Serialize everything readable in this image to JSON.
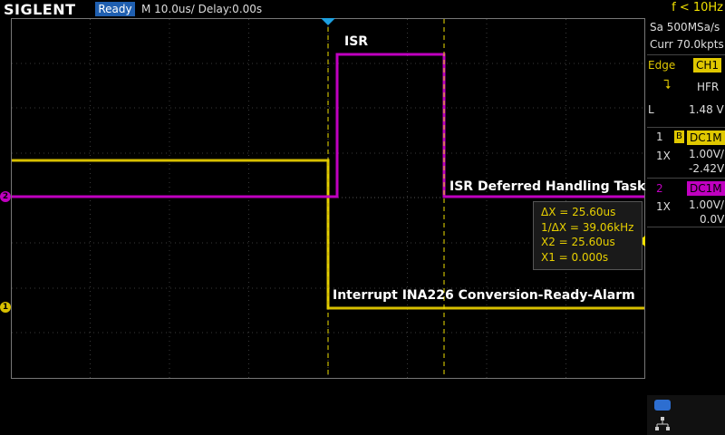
{
  "topbar": {
    "logo": "SIGLENT",
    "status": "Ready",
    "timebase": "M 10.0us/  Delay:0.00s",
    "frequency": "f < 10Hz"
  },
  "acquisition": {
    "sample_rate": "Sa 500MSa/s",
    "memory": "Curr 70.0kpts"
  },
  "trigger": {
    "type": "Edge",
    "source": "CH1",
    "coupling": "HFR",
    "level_prefix": "L",
    "level": "1.48 V"
  },
  "channels": [
    {
      "number": "1",
      "bw": "B",
      "coupling": "DC1M",
      "probe": "1X",
      "scale": "1.00V/",
      "offset": "-2.42V",
      "color": "#e0c800"
    },
    {
      "number": "2",
      "coupling": "DC1M",
      "probe": "1X",
      "scale": "1.00V/",
      "offset": "0.0V",
      "color": "#c000c0"
    }
  ],
  "labels": {
    "isr": "ISR",
    "deferred": "ISR Deferred Handling Task",
    "interrupt": "Interrupt INA226 Conversion-Ready-Alarm"
  },
  "cursors": {
    "delta_x": "ΔX = 25.60us",
    "inv_delta_x": "1/ΔX = 39.06kHz",
    "x2": "X2 = 25.60us",
    "x1": "X1 = 0.000s"
  },
  "markers": {
    "ch1": "1",
    "ch2": "2"
  }
}
